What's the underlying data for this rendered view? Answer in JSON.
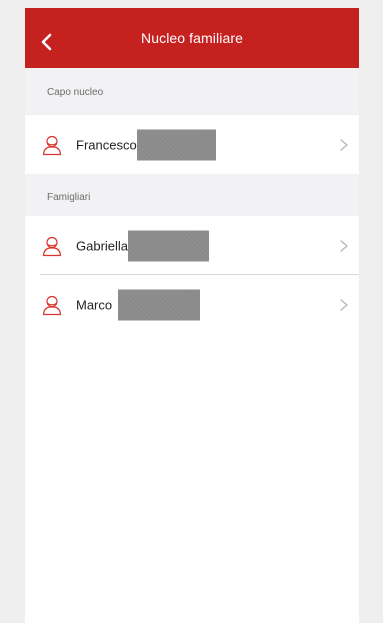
{
  "header": {
    "title": "Nucleo familiare",
    "back_icon": "chevron-left-icon",
    "bg_color": "#c5221f"
  },
  "sections": [
    {
      "label": "Capo nucleo",
      "members": [
        {
          "name": "Francesco",
          "icon": "user-outline-icon",
          "redacted": true
        }
      ]
    },
    {
      "label": "Famigliari",
      "members": [
        {
          "name": "Gabriella",
          "icon": "user-outline-icon",
          "redacted": true
        },
        {
          "name": "Marco",
          "icon": "user-outline-icon",
          "redacted": true
        }
      ]
    }
  ],
  "colors": {
    "accent": "#c5221f",
    "icon_red": "#d9342b",
    "chevron": "#b8b8b8",
    "redaction": "#8a8a8a"
  }
}
